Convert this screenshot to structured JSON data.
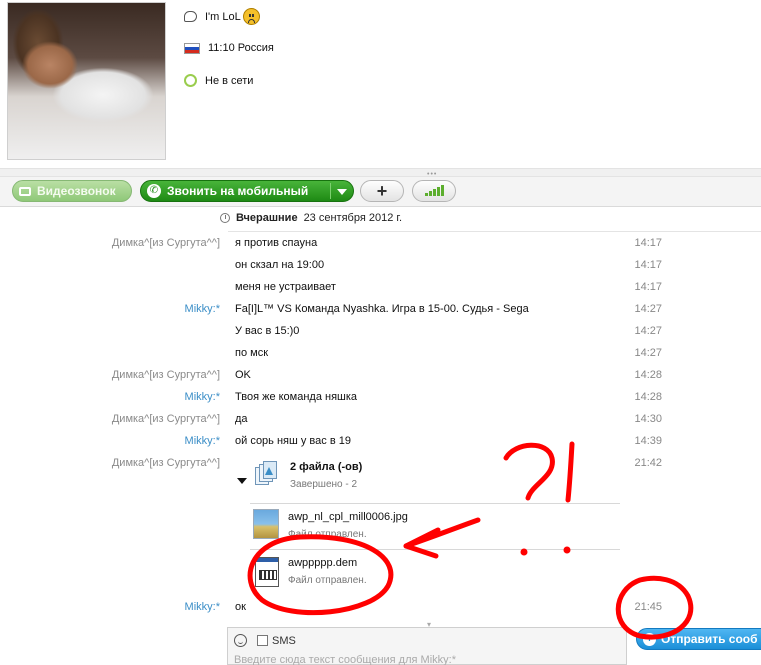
{
  "profile": {
    "mood": "I'm LoL",
    "local_time": "11:10 Россия",
    "status": "Не в сети"
  },
  "actions": {
    "video_call": "Видеозвонок",
    "call_mobile": "Звонить на мобильный"
  },
  "chat": {
    "day_label": "Вчерашние",
    "day_date": "23 сентября 2012 г.",
    "messages": [
      {
        "sender": "Димка^[из Сургута^^]",
        "text": "я против спауна",
        "time": "14:17"
      },
      {
        "sender": "",
        "text": "он скзал на 19:00",
        "time": "14:17"
      },
      {
        "sender": "",
        "text": "меня не устраивает",
        "time": "14:17"
      },
      {
        "sender": "Mikky:*",
        "text": "Fa[I]L™ VS Команда Nyashka. Игра в 15-00. Судья - Sega",
        "time": "14:27"
      },
      {
        "sender": "",
        "text": "У вас в 15:)0",
        "time": "14:27"
      },
      {
        "sender": "",
        "text": "по мск",
        "time": "14:27"
      },
      {
        "sender": "Димка^[из Сургута^^]",
        "text": "OK",
        "time": "14:28"
      },
      {
        "sender": "Mikky:*",
        "text": "Твоя же команда няшка",
        "time": "14:28"
      },
      {
        "sender": "Димка^[из Сургута^^]",
        "text": "да",
        "time": "14:30"
      },
      {
        "sender": "Mikky:*",
        "text": "ой сорь няш у вас в 19",
        "time": "14:39"
      },
      {
        "sender": "Димка^[из Сургута^^]",
        "text": "",
        "time": "21:42"
      },
      {
        "sender": "Mikky:*",
        "text": "ок",
        "time": "21:45"
      }
    ],
    "transfer": {
      "title": "2 файла (-ов)",
      "status": "Завершено - 2",
      "files": [
        {
          "name": "awp_nl_cpl_mill0006.jpg",
          "status": "Файл отправлен."
        },
        {
          "name": "awppppp.dem",
          "status": "Файл отправлен."
        }
      ]
    }
  },
  "composer": {
    "sms_label": "SMS",
    "placeholder": "Введите сюда текст сообщения для Mikky:*",
    "send_label": "Отправить сооб"
  },
  "annotation": {
    "text": "?!",
    "color": "#ff0000"
  }
}
